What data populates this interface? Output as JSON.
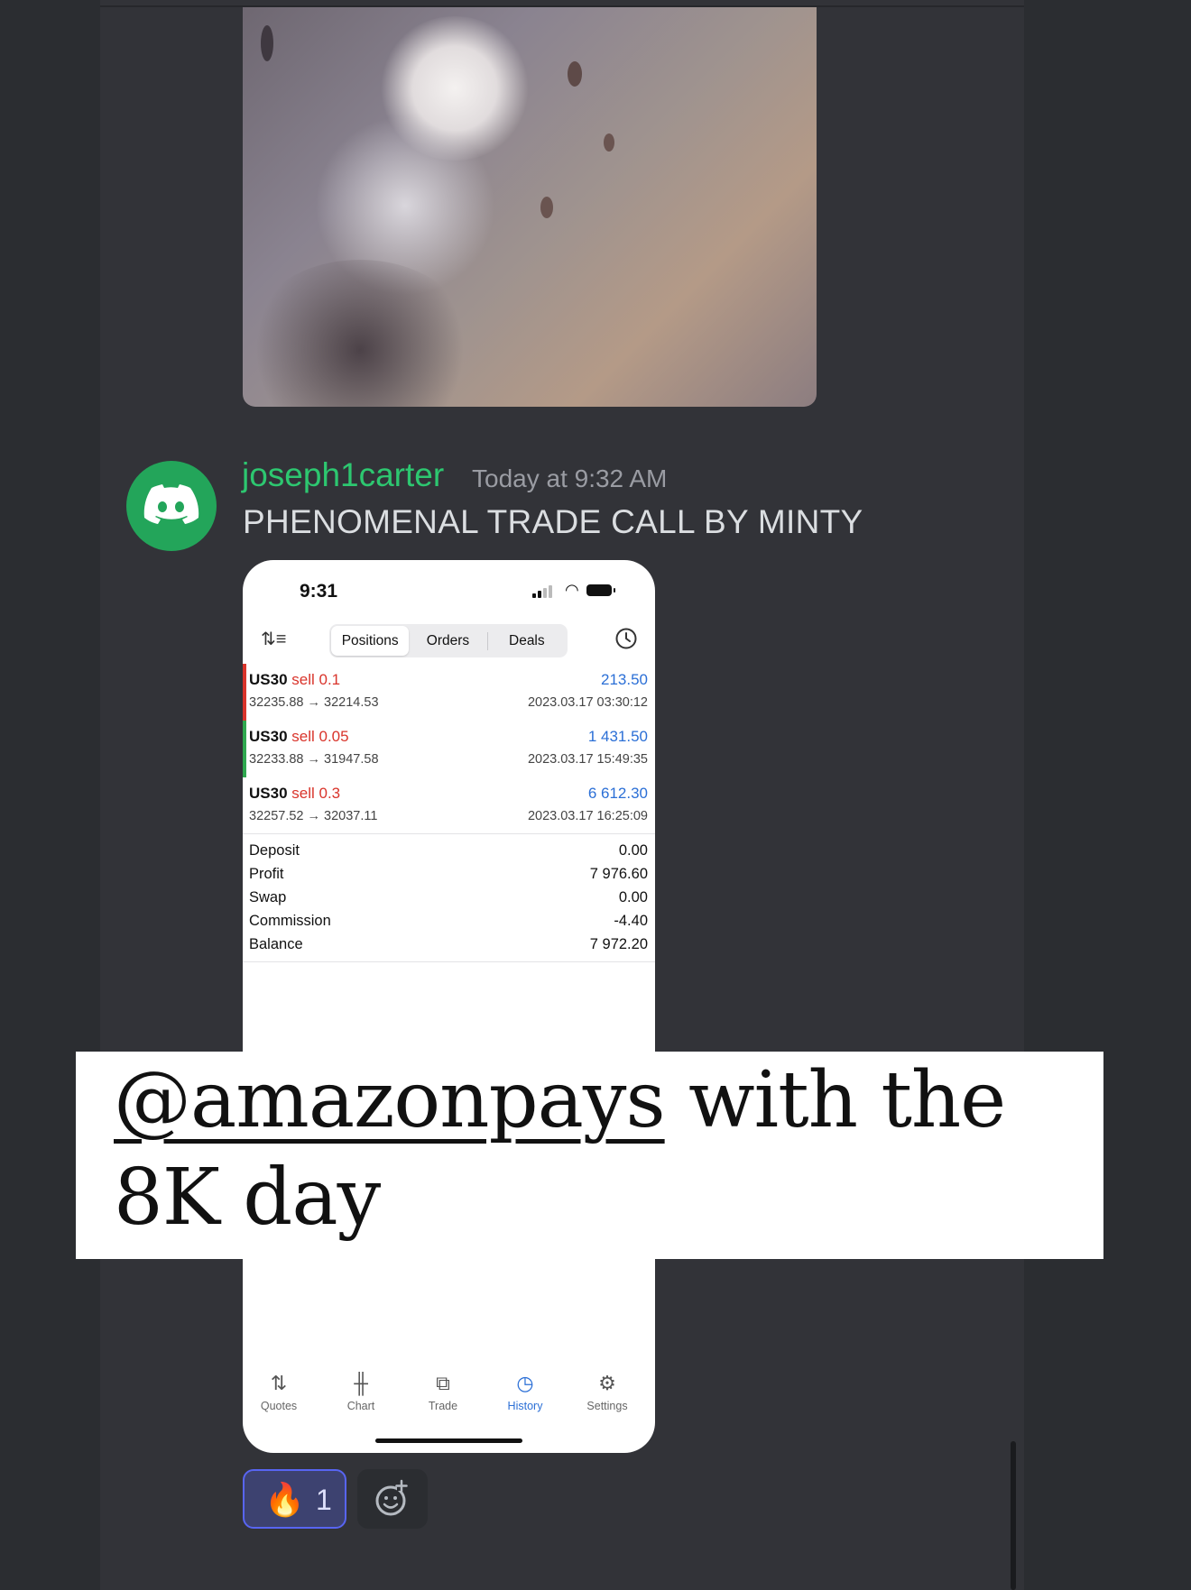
{
  "message": {
    "username": "joseph1carter",
    "timestamp": "Today at 9:32 AM",
    "text": "PHENOMENAL TRADE CALL BY MINTY"
  },
  "phone": {
    "status_time": "9:31",
    "tabs": [
      "Positions",
      "Orders",
      "Deals"
    ],
    "active_tab": "Positions",
    "trades": [
      {
        "symbol": "US30",
        "direction": "sell 0.1",
        "prices": "32235.88 → 32214.53",
        "profit": "213.50",
        "date": "2023.03.17 03:30:12",
        "marker_color": "#d9342b"
      },
      {
        "symbol": "US30",
        "direction": "sell 0.05",
        "prices": "32233.88 → 31947.58",
        "profit": "1 431.50",
        "date": "2023.03.17 15:49:35",
        "marker_color": "#2fa84f"
      },
      {
        "symbol": "US30",
        "direction": "sell 0.3",
        "prices": "32257.52 → 32037.11",
        "profit": "6 612.30",
        "date": "2023.03.17 16:25:09",
        "marker_color": "#ffffff"
      }
    ],
    "summary": [
      {
        "label": "Deposit",
        "value": "0.00"
      },
      {
        "label": "Profit",
        "value": "7 976.60"
      },
      {
        "label": "Swap",
        "value": "0.00"
      },
      {
        "label": "Commission",
        "value": "-4.40"
      },
      {
        "label": "Balance",
        "value": "7 972.20"
      }
    ],
    "nav": [
      {
        "label": "Quotes",
        "icon": "quotes-icon"
      },
      {
        "label": "Chart",
        "icon": "chart-icon"
      },
      {
        "label": "Trade",
        "icon": "trade-icon"
      },
      {
        "label": "History",
        "icon": "history-icon"
      },
      {
        "label": "Settings",
        "icon": "settings-icon"
      }
    ],
    "active_nav": "History"
  },
  "overlay": {
    "mention": "@amazonpays",
    "line1_rest": " with the",
    "line2": "8K day"
  },
  "reaction": {
    "emoji": "🔥",
    "count": "1"
  },
  "colors": {
    "username": "#2dc770",
    "profit": "#2b6fd6",
    "sell": "#d9342b",
    "reaction_border": "#5865f2"
  }
}
